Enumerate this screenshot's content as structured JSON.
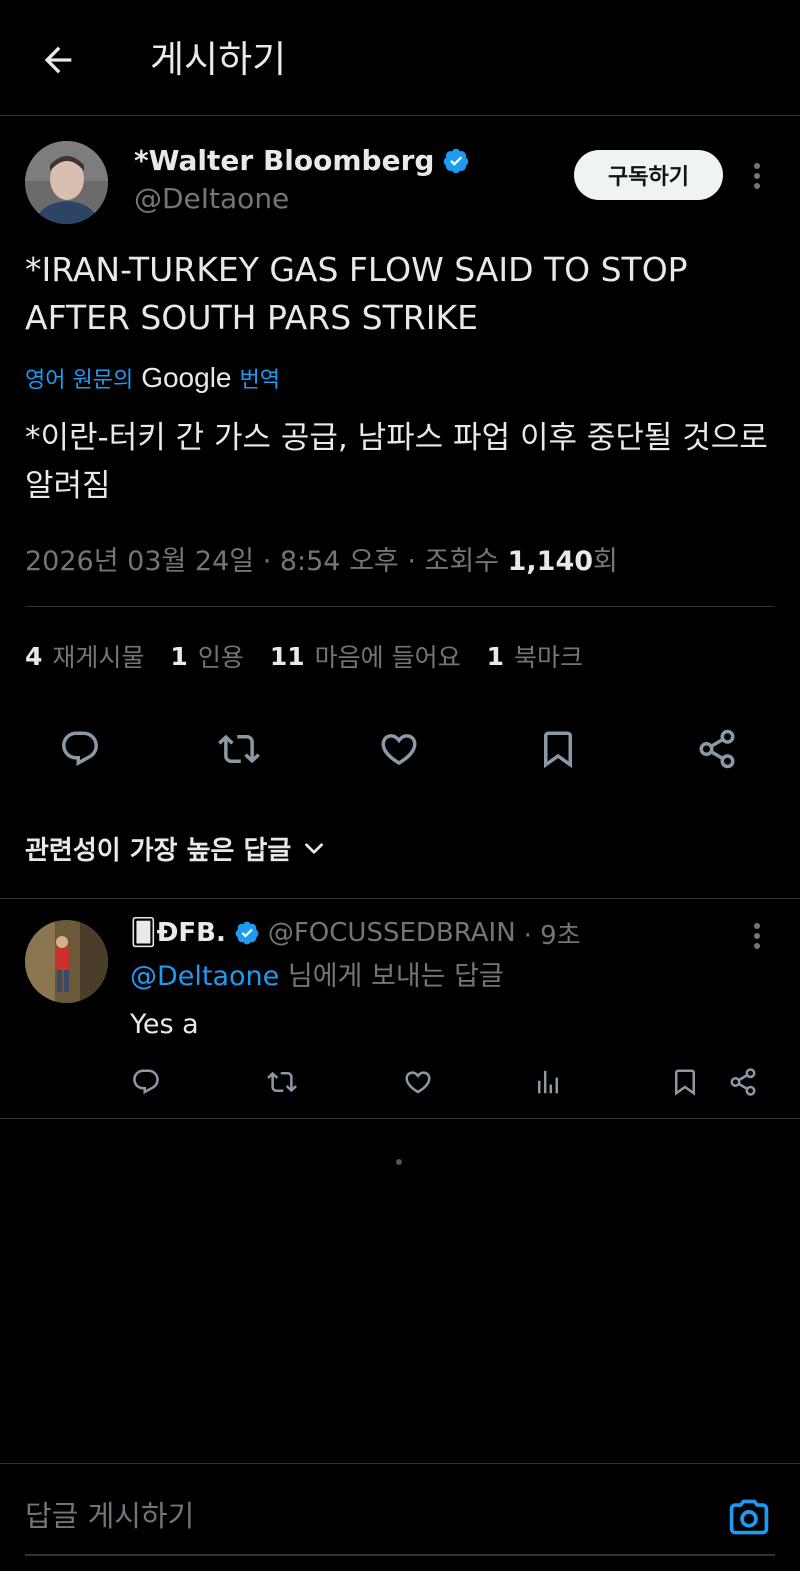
{
  "header": {
    "title": "게시하기"
  },
  "author": {
    "name": "*Walter Bloomberg",
    "handle": "@DeItaone",
    "subscribe_label": "구독하기"
  },
  "tweet": {
    "text": "*IRAN-TURKEY GAS FLOW SAID TO STOP AFTER SOUTH PARS STRIKE",
    "translate_prefix": "영어 원문의",
    "translate_brand": "Google",
    "translate_suffix": "번역",
    "translated_text": "*이란-터키 간 가스 공급, 남파스 파업 이후 중단될 것으로 알려짐",
    "timestamp": "2026년 03월 24일 · 8:54 오후 · 조회수",
    "views_count": "1,140",
    "views_suffix": "회"
  },
  "stats": [
    {
      "count": "4",
      "label": "재게시물"
    },
    {
      "count": "1",
      "label": "인용"
    },
    {
      "count": "11",
      "label": "마음에 들어요"
    },
    {
      "count": "1",
      "label": "북마크"
    }
  ],
  "actions": [
    "reply-icon",
    "repost-icon",
    "like-icon",
    "bookmark-icon",
    "share-icon"
  ],
  "replies_sort": {
    "label": "관련성이 가장 높은 답글"
  },
  "reply": {
    "name": "🂠ĐFB.",
    "handle": "@FOCUSSEDBRAIN",
    "time": "· 9초",
    "reply_to_handle": "@Deltaone",
    "reply_to_suffix": "님에게 보내는 답글",
    "text": "Yes a"
  },
  "compose": {
    "placeholder": "답글 게시하기"
  },
  "colors": {
    "background": "#000000",
    "accent": "#1d9bf0",
    "muted": "#71767b",
    "text": "#e7e9ea",
    "border": "#2f3336"
  }
}
